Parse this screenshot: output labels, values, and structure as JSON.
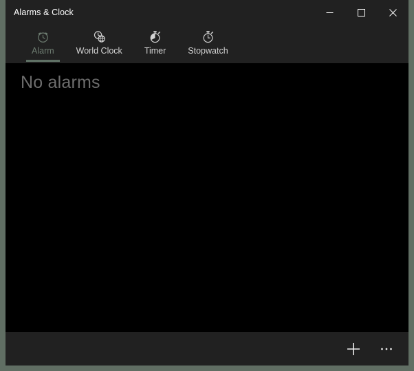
{
  "window": {
    "title": "Alarms & Clock",
    "border_color": "#606e63",
    "chrome_color": "#212121",
    "content_color": "#000000"
  },
  "caption_buttons": [
    {
      "name": "minimize",
      "label": "Minimize",
      "icon": "minimize-icon"
    },
    {
      "name": "maximize",
      "label": "Maximize",
      "icon": "maximize-icon"
    },
    {
      "name": "close",
      "label": "Close",
      "icon": "close-icon"
    }
  ],
  "tabs": [
    {
      "label": "Alarm",
      "icon": "alarm-clock-icon",
      "active": true
    },
    {
      "label": "World Clock",
      "icon": "world-clock-icon",
      "active": false
    },
    {
      "label": "Timer",
      "icon": "timer-icon",
      "active": false
    },
    {
      "label": "Stopwatch",
      "icon": "stopwatch-icon",
      "active": false
    }
  ],
  "tab_colors": {
    "active_text": "#6e7d71",
    "active_underline": "#5f7165",
    "inactive_text": "#d2d2d2"
  },
  "content": {
    "empty_state": "No alarms",
    "empty_state_color": "#6d6d6d"
  },
  "command_bar": {
    "add_label": "Add new alarm",
    "add_icon": "plus-icon",
    "more_label": "See more",
    "more_icon": "ellipsis-icon"
  }
}
